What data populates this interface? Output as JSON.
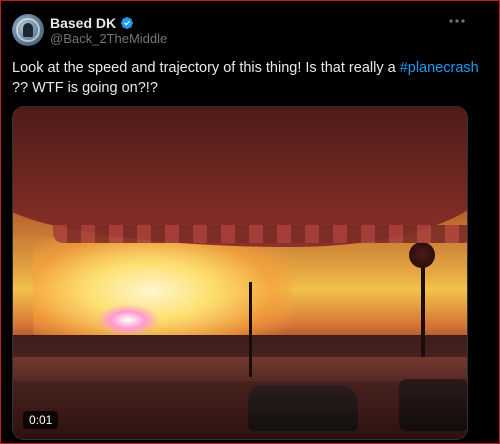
{
  "post": {
    "display_name": "Based DK",
    "handle": "@Back_2TheMiddle",
    "verified_icon": "verified-badge-icon",
    "more_icon": "more-options-icon",
    "text_before": "Look at the speed and trajectory of this thing! Is that really a ",
    "hashtag": "#planecrash",
    "text_after": " ?? WTF is going on?!?",
    "media": {
      "duration": "0:01"
    }
  },
  "colors": {
    "background": "#000000",
    "text": "#e7e9ea",
    "secondary_text": "#71767b",
    "link": "#1d9bf0",
    "verified": "#1d9bf0",
    "frame_border": "#c4161c"
  }
}
